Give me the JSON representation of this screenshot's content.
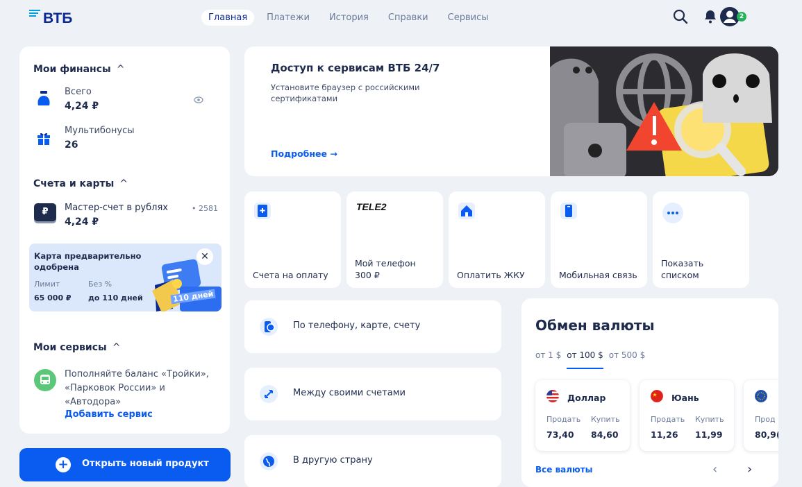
{
  "header": {
    "logo_text": "ВТБ",
    "tabs": [
      {
        "label": "Главная",
        "active": true
      },
      {
        "label": "Платежи",
        "active": false
      },
      {
        "label": "История",
        "active": false
      },
      {
        "label": "Справки",
        "active": false
      },
      {
        "label": "Сервисы",
        "active": false
      }
    ],
    "notifications_badge": "2"
  },
  "finances": {
    "title": "Мои финансы",
    "total_label": "Всего",
    "total_value": "4,24 ₽",
    "bonus_label": "Мультибонусы",
    "bonus_value": "26"
  },
  "accounts": {
    "title": "Счета и карты",
    "account_name": "Мастер-счет в рублях",
    "account_number": "• 2581",
    "account_balance": "4,24 ₽",
    "account_icon_glyph": "₽"
  },
  "promo": {
    "title": "Карта предварительно одобрена",
    "limit_label": "Лимит",
    "limit_value": "65 000 ₽",
    "interest_label": "Без %",
    "interest_value": "до 110 дней",
    "card_text": "110 дней"
  },
  "services": {
    "title": "Мои сервисы",
    "description": "Пополняйте баланс «Тройки», «Парковок России» и «Автодора»",
    "add_link": "Добавить сервис"
  },
  "open_product_label": "Открыть новый продукт",
  "banner": {
    "title": "Доступ к сервисам ВТБ 24/7",
    "subtitle": "Установите браузер с российскими сертификатами",
    "link": "Подробнее →"
  },
  "tiles": [
    {
      "label": "Счета на оплату",
      "icon": "invoice-icon"
    },
    {
      "label": "Мой телефон\n300 ₽",
      "icon": "tele2-logo",
      "brand": "TELE2"
    },
    {
      "label": "Оплатить ЖКУ",
      "icon": "house-icon"
    },
    {
      "label": "Мобильная связь",
      "icon": "phone-icon"
    },
    {
      "label": "Показать\nсписком",
      "icon": "more-icon"
    }
  ],
  "transfers": [
    {
      "label": "По телефону, карте, счету",
      "icon": "phone-transfer-icon"
    },
    {
      "label": "Между своими счетами",
      "icon": "arrows-icon"
    },
    {
      "label": "В другую страну",
      "icon": "globe-icon"
    }
  ],
  "exchange": {
    "title": "Обмен валюты",
    "tabs": [
      {
        "label": "от 1 $",
        "active": false
      },
      {
        "label": "от 100 $",
        "active": true
      },
      {
        "label": "от 500 $",
        "active": false
      }
    ],
    "currencies": [
      {
        "name": "Доллар",
        "sell_label": "Продать",
        "buy_label": "Купить",
        "sell": "73,40",
        "buy": "84,60",
        "flag": "us-flag-icon"
      },
      {
        "name": "Юань",
        "sell_label": "Продать",
        "buy_label": "Купить",
        "sell": "11,26",
        "buy": "11,99",
        "flag": "cn-flag-icon"
      },
      {
        "name": "",
        "sell_label": "Прод",
        "buy_label": "",
        "sell": "80,9(",
        "buy": "",
        "flag": "eu-flag-icon"
      }
    ],
    "all_link": "Все валюты"
  },
  "colors": {
    "brand_blue": "#0a2896",
    "accent_blue": "#0a5cf0",
    "background": "#eef2f7",
    "success_green": "#24b35b"
  }
}
